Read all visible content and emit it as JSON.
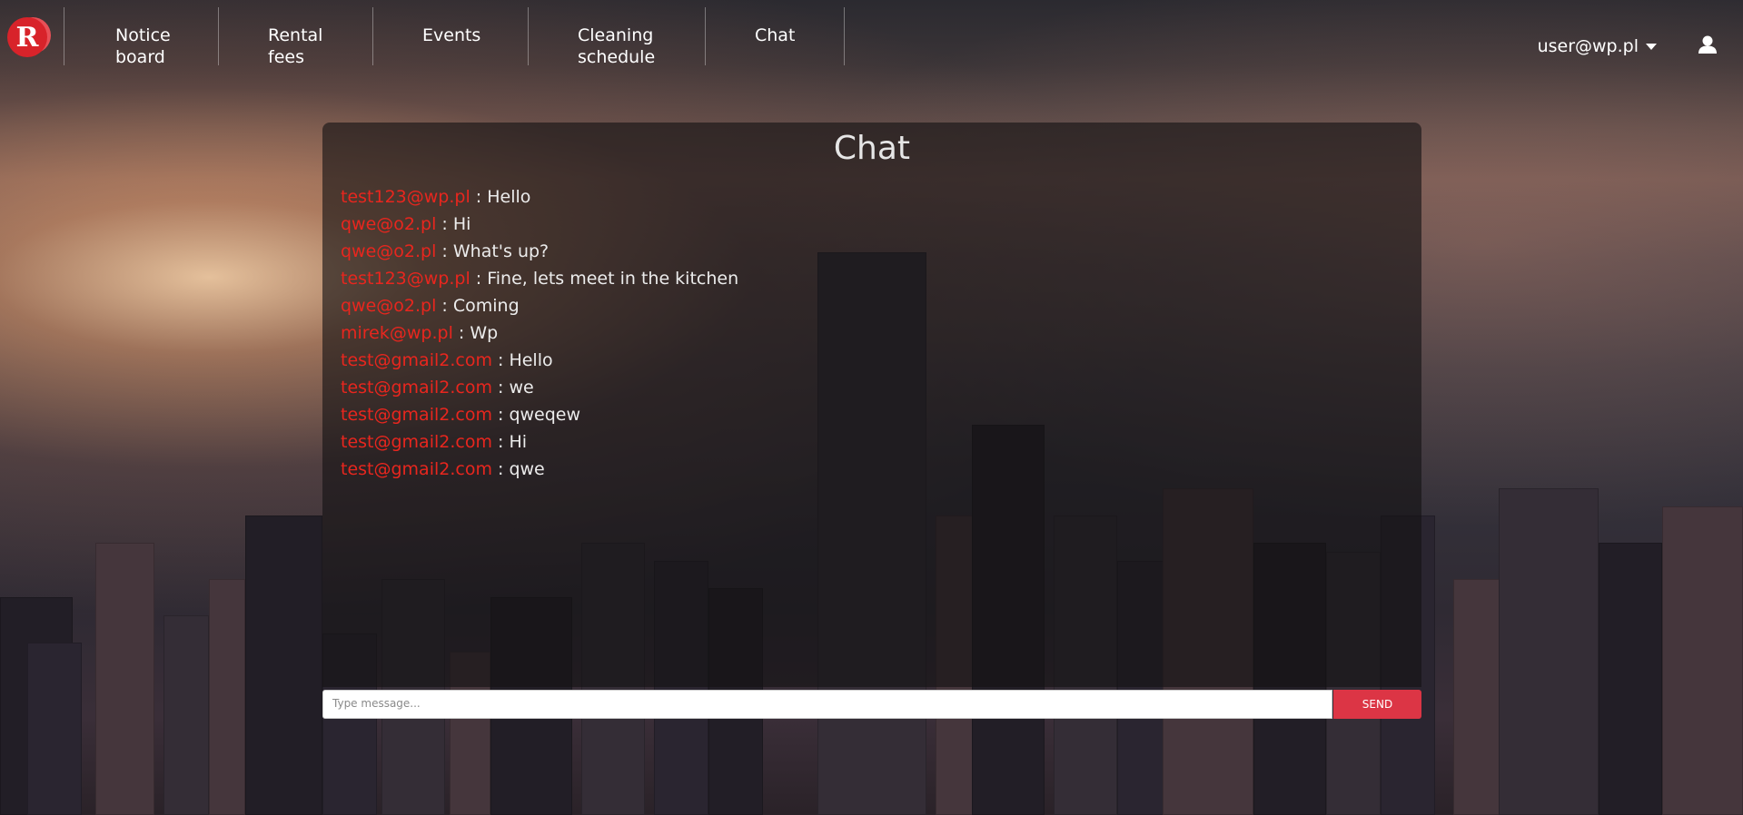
{
  "nav": {
    "logo_letter": "R",
    "items": [
      {
        "line1": "Notice",
        "line2": "board"
      },
      {
        "line1": "Rental",
        "line2": "fees"
      },
      {
        "line1": "Events",
        "line2": ""
      },
      {
        "line1": "Cleaning",
        "line2": "schedule"
      },
      {
        "line1": "Chat",
        "line2": ""
      }
    ],
    "user_email": "user@wp.pl",
    "user_icon": "user-icon"
  },
  "chat": {
    "title": "Chat",
    "separator": " : ",
    "messages": [
      {
        "author": "test123@wp.pl",
        "text": "Hello"
      },
      {
        "author": "qwe@o2.pl",
        "text": "Hi"
      },
      {
        "author": "qwe@o2.pl",
        "text": "What's up?"
      },
      {
        "author": "test123@wp.pl",
        "text": "Fine, lets meet in the kitchen"
      },
      {
        "author": "qwe@o2.pl",
        "text": "Coming"
      },
      {
        "author": "mirek@wp.pl",
        "text": "Wp"
      },
      {
        "author": "test@gmail2.com",
        "text": "Hello"
      },
      {
        "author": "test@gmail2.com",
        "text": "we"
      },
      {
        "author": "test@gmail2.com",
        "text": "qweqew"
      },
      {
        "author": "test@gmail2.com",
        "text": "Hi"
      },
      {
        "author": "test@gmail2.com",
        "text": "qwe"
      }
    ],
    "input_placeholder": "Type message...",
    "input_value": "",
    "send_label": "SEND"
  },
  "colors": {
    "accent": "#dc3545",
    "author": "#e8261e",
    "logo": "#d8232a"
  }
}
